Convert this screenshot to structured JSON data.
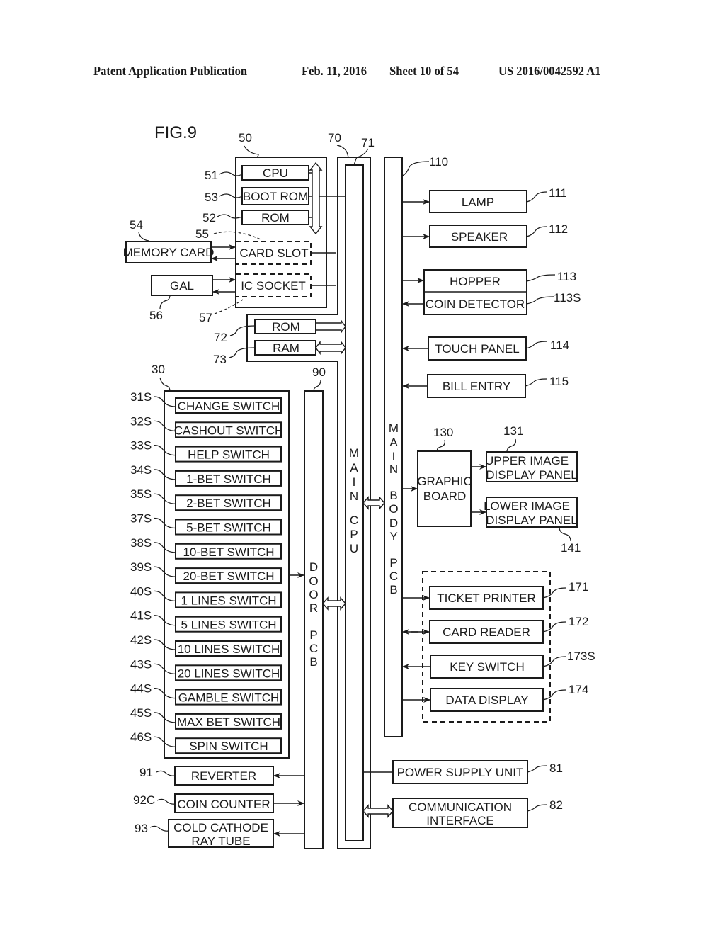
{
  "header": {
    "publication": "Patent Application Publication",
    "date": "Feb. 11, 2016",
    "sheet": "Sheet 10 of 54",
    "number": "US 2016/0042592 A1"
  },
  "figure": {
    "title": "FIG.9",
    "unit50": {
      "ref": "50",
      "cpu": {
        "label": "CPU",
        "ref": "51"
      },
      "boot_rom": {
        "label": "BOOT ROM",
        "ref": "53"
      },
      "rom": {
        "label": "ROM",
        "ref": "52"
      },
      "card_slot": {
        "label": "CARD SLOT",
        "ref": "55"
      },
      "ic_socket": {
        "label": "IC SOCKET",
        "ref": "57"
      }
    },
    "memory_card": {
      "label": "MEMORY CARD",
      "ref": "54"
    },
    "gal": {
      "label": "GAL",
      "ref": "56"
    },
    "main_cpu": {
      "ref_outer": "70",
      "ref_inner": "71",
      "label": "MAIN CPU"
    },
    "rom72": {
      "label": "ROM",
      "ref": "72"
    },
    "ram73": {
      "label": "RAM",
      "ref": "73"
    },
    "main_body_pcb": {
      "label": "MAIN BODY PCB",
      "ref": "110"
    },
    "door_pcb": {
      "label": "DOOR PCB",
      "ref": "90"
    },
    "peripherals": [
      {
        "label": "LAMP",
        "ref": "111"
      },
      {
        "label": "SPEAKER",
        "ref": "112"
      },
      {
        "label": "HOPPER",
        "ref": "113"
      },
      {
        "label": "COIN DETECTOR",
        "ref": "113S"
      },
      {
        "label": "TOUCH PANEL",
        "ref": "114"
      },
      {
        "label": "BILL ENTRY",
        "ref": "115"
      }
    ],
    "graphic_board": {
      "line1": "GRAPHIC",
      "line2": "BOARD",
      "ref": "130"
    },
    "upper_panel": {
      "line1": "UPPER IMAGE",
      "line2": "DISPLAY PANEL",
      "ref": "131"
    },
    "lower_panel": {
      "line1": "LOWER IMAGE",
      "line2": "DISPLAY PANEL",
      "ref": "141"
    },
    "group170": [
      {
        "label": "TICKET PRINTER",
        "ref": "171"
      },
      {
        "label": "CARD READER",
        "ref": "172"
      },
      {
        "label": "KEY SWITCH",
        "ref": "173S"
      },
      {
        "label": "DATA DISPLAY",
        "ref": "174"
      }
    ],
    "power_supply": {
      "label": "POWER SUPPLY UNIT",
      "ref": "81"
    },
    "comm_interface": {
      "line1": "COMMUNICATION",
      "line2": "INTERFACE",
      "ref": "82"
    },
    "switch_panel": {
      "ref": "30",
      "switches": [
        {
          "label": "CHANGE SWITCH",
          "ref": "31S"
        },
        {
          "label": "CASHOUT SWITCH",
          "ref": "32S"
        },
        {
          "label": "HELP SWITCH",
          "ref": "33S"
        },
        {
          "label": "1-BET SWITCH",
          "ref": "34S"
        },
        {
          "label": "2-BET SWITCH",
          "ref": "35S"
        },
        {
          "label": "5-BET SWITCH",
          "ref": "37S"
        },
        {
          "label": "10-BET SWITCH",
          "ref": "38S"
        },
        {
          "label": "20-BET SWITCH",
          "ref": "39S"
        },
        {
          "label": "1 LINES SWITCH",
          "ref": "40S"
        },
        {
          "label": "5 LINES SWITCH",
          "ref": "41S"
        },
        {
          "label": "10 LINES SWITCH",
          "ref": "42S"
        },
        {
          "label": "20 LINES SWITCH",
          "ref": "43S"
        },
        {
          "label": "GAMBLE SWITCH",
          "ref": "44S"
        },
        {
          "label": "MAX BET SWITCH",
          "ref": "45S"
        },
        {
          "label": "SPIN SWITCH",
          "ref": "46S"
        }
      ]
    },
    "door_devices": [
      {
        "label": "REVERTER",
        "ref": "91"
      },
      {
        "label": "COIN COUNTER",
        "ref": "92C"
      },
      {
        "line1": "COLD CATHODE",
        "line2": "RAY TUBE",
        "ref": "93"
      }
    ]
  }
}
